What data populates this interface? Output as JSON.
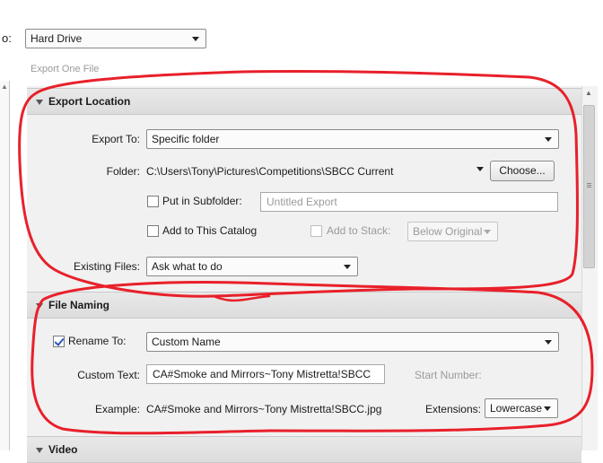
{
  "top": {
    "label": "o:",
    "destination": "Hard Drive",
    "subtitle": "Export One File"
  },
  "export_location": {
    "title": "Export Location",
    "export_to_label": "Export To:",
    "export_to_value": "Specific folder",
    "folder_label": "Folder:",
    "folder_path": "C:\\Users\\Tony\\Pictures\\Competitions\\SBCC Current",
    "choose_button": "Choose...",
    "put_in_subfolder_label": "Put in Subfolder:",
    "subfolder_placeholder": "Untitled Export",
    "add_to_catalog_label": "Add to This Catalog",
    "add_to_stack_label": "Add to Stack:",
    "stack_position": "Below Original",
    "existing_files_label": "Existing Files:",
    "existing_files_value": "Ask what to do"
  },
  "file_naming": {
    "title": "File Naming",
    "rename_to_label": "Rename To:",
    "rename_to_value": "Custom Name",
    "custom_text_label": "Custom Text:",
    "custom_text_value": "CA#Smoke and Mirrors~Tony Mistretta!SBCC",
    "start_number_label": "Start Number:",
    "example_label": "Example:",
    "example_value": "CA#Smoke and Mirrors~Tony Mistretta!SBCC.jpg",
    "extensions_label": "Extensions:",
    "extensions_value": "Lowercase"
  },
  "video": {
    "title": "Video"
  },
  "colors": {
    "annotation": "#e8202a",
    "checkbox_accent": "#2a57b8"
  }
}
